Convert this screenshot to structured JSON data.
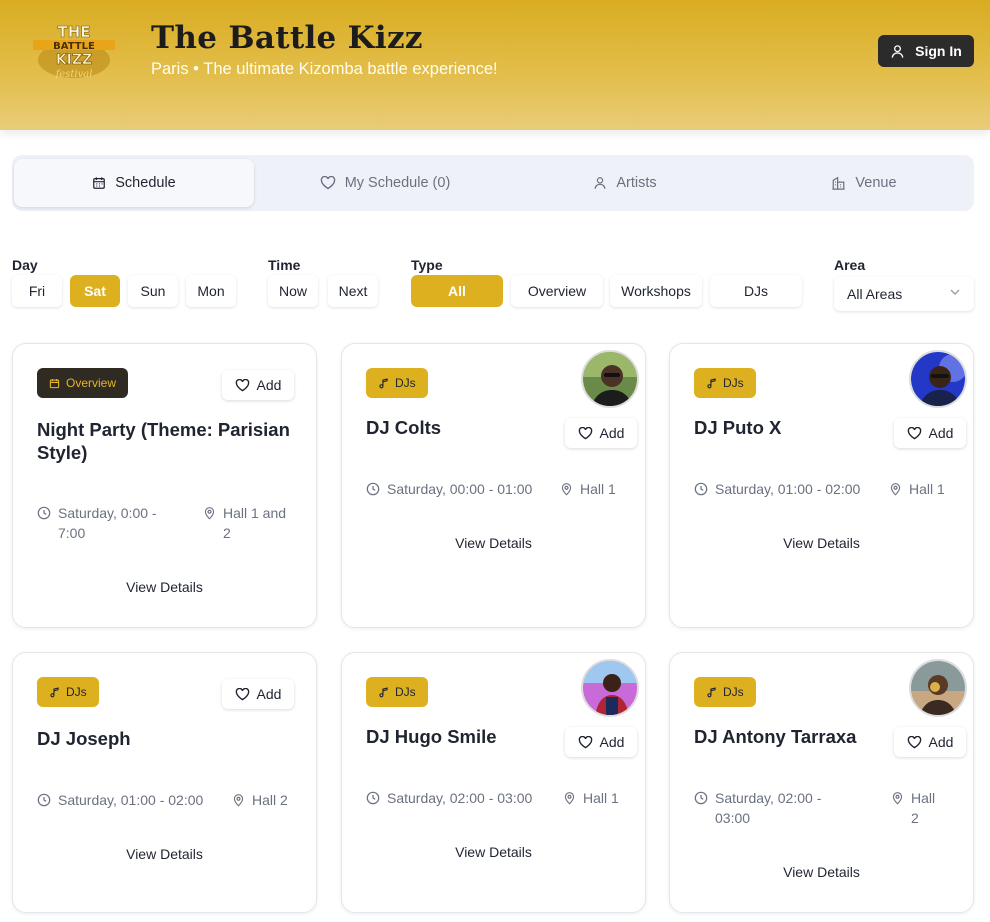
{
  "header": {
    "title": "The Battle Kizz",
    "subtitle": "Paris • The ultimate Kizomba battle experience!",
    "logo_text": "THE BATTLE KIZZ",
    "signin_label": "Sign In"
  },
  "tabs": [
    {
      "label": "Schedule",
      "icon": "calendar-icon",
      "active": true
    },
    {
      "label": "My Schedule (0)",
      "icon": "heart-icon",
      "active": false
    },
    {
      "label": "Artists",
      "icon": "user-icon",
      "active": false
    },
    {
      "label": "Venue",
      "icon": "building-icon",
      "active": false
    }
  ],
  "filters": {
    "day": {
      "label": "Day",
      "options": [
        "Fri",
        "Sat",
        "Sun",
        "Mon"
      ],
      "selected": "Sat"
    },
    "time": {
      "label": "Time",
      "options": [
        "Now",
        "Next"
      ]
    },
    "type": {
      "label": "Type",
      "options": [
        "All",
        "Overview",
        "Workshops",
        "DJs"
      ],
      "selected": "All"
    },
    "area": {
      "label": "Area",
      "value": "All Areas"
    }
  },
  "cards": [
    {
      "badge": "Overview",
      "title_line1": "Night Party (Theme: Parisian",
      "title_line2": "Style)",
      "time_line1": "Saturday, 0:00 -",
      "time_line2": "7:00",
      "loc_line1": "Hall 1 and",
      "loc_line2": "2",
      "add_label": "Add",
      "details_label": "View Details"
    },
    {
      "badge": "DJs",
      "title": "DJ Colts",
      "time": "Saturday, 00:00 - 01:00",
      "location": "Hall 1",
      "add_label": "Add",
      "details_label": "View Details"
    },
    {
      "badge": "DJs",
      "title": "DJ Puto X",
      "time": "Saturday, 01:00 - 02:00",
      "location": "Hall 1",
      "add_label": "Add",
      "details_label": "View Details"
    },
    {
      "badge": "DJs",
      "title": "DJ Joseph",
      "time": "Saturday, 01:00 - 02:00",
      "location": "Hall 2",
      "add_label": "Add",
      "details_label": "View Details"
    },
    {
      "badge": "DJs",
      "title": "DJ Hugo Smile",
      "time": "Saturday, 02:00 - 03:00",
      "location": "Hall 1",
      "add_label": "Add",
      "details_label": "View Details"
    },
    {
      "badge": "DJs",
      "title": "DJ Antony Tarraxa",
      "time_line1": "Saturday, 02:00 -",
      "time_line2": "03:00",
      "loc_line1": "Hall",
      "loc_line2": "2",
      "add_label": "Add",
      "details_label": "View Details"
    }
  ],
  "colors": {
    "accent": "#ddb01f",
    "dark": "#2b2b2b",
    "text": "#1f2430",
    "muted": "#6a7180"
  }
}
